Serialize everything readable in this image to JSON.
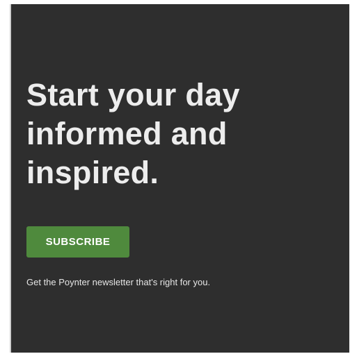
{
  "promo": {
    "headline": "Start your day informed and inspired.",
    "subscribe_label": "SUBSCRIBE",
    "tagline": "Get the Poynter newsletter that's right for you."
  },
  "colors": {
    "background": "#2e2e2e",
    "button": "#4f8a3d",
    "text": "#ededed"
  }
}
